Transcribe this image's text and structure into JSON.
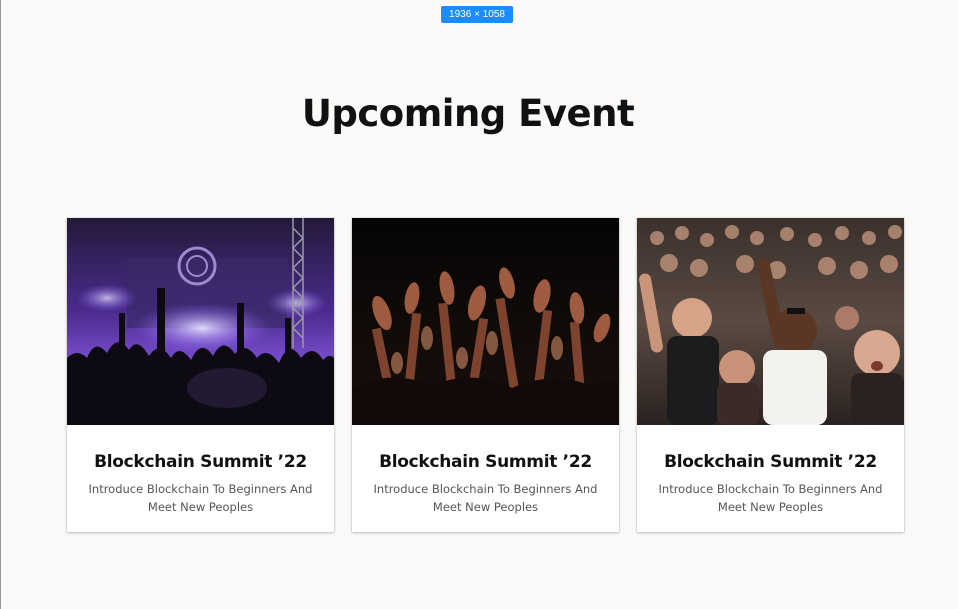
{
  "overlay": {
    "dimensions_badge": "1936 × 1058"
  },
  "section": {
    "title": "Upcoming Event"
  },
  "events": [
    {
      "image_icon": "concert-stage-photo",
      "title": "Blockchain Summit ’22",
      "description": "Introduce Blockchain To Beginners And Meet New Peoples"
    },
    {
      "image_icon": "raised-hands-crowd-photo",
      "title": "Blockchain Summit ’22",
      "description": "Introduce Blockchain To Beginners And Meet New Peoples"
    },
    {
      "image_icon": "cheering-audience-photo",
      "title": "Blockchain Summit ’22",
      "description": "Introduce Blockchain To Beginners And Meet New Peoples"
    }
  ],
  "colors": {
    "background": "#fbfaf8",
    "card": "#ffffff",
    "title_text": "#111111",
    "body_text": "#555555",
    "badge": "#1a8cff"
  }
}
